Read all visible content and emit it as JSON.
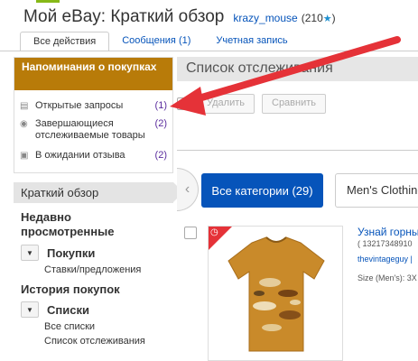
{
  "header": {
    "title": "Мой eBay: Краткий обзор",
    "username": "krazy_mouse",
    "rating": "(210",
    "rating_close": ")"
  },
  "tabs": [
    {
      "label": "Все действия",
      "active": true
    },
    {
      "label": "Сообщения (1)",
      "active": false
    },
    {
      "label": "Учетная запись",
      "active": false
    }
  ],
  "reminders": {
    "title": "Напоминания о покупках",
    "items": [
      {
        "icon": "document-icon",
        "label": "Открытые запросы",
        "count": "(1)"
      },
      {
        "icon": "eye-icon",
        "label": "Завершающиеся отслеживаемые товары",
        "count": "(2)"
      },
      {
        "icon": "package-icon",
        "label": "В ожидании отзыва",
        "count": "(2)"
      }
    ]
  },
  "sidebar": {
    "summary": "Краткий обзор",
    "recent": "Недавно просмотренные",
    "purchases": "Покупки",
    "bids": "Ставки/предложения",
    "history": "История покупок",
    "lists": "Списки",
    "all_lists": "Все списки",
    "watchlist": "Список отслеживания"
  },
  "main": {
    "title": "Список отслеживания",
    "delete_label": "Удалить",
    "compare_label": "Сравнить",
    "categories_label": "Все категории (29)",
    "filter_label": "Men's Clothing"
  },
  "item": {
    "title": "Узнай горны",
    "number": "( 13217348910",
    "seller": "thevintageguy |",
    "size": "Size (Men's): 3X"
  },
  "colors": {
    "accent": "#b87b09",
    "link": "#0654ba",
    "arrow": "#e53238",
    "tshirt": "#c98a2a"
  }
}
